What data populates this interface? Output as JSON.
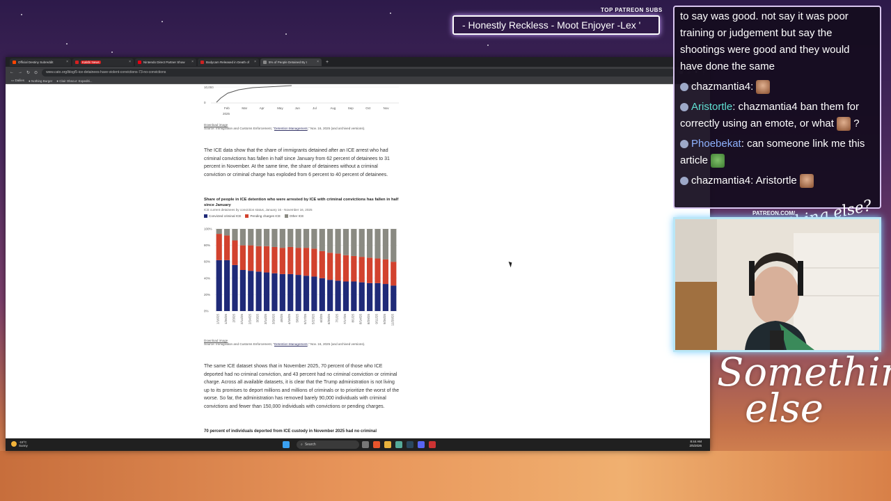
{
  "overlay": {
    "patreon_label": "TOP PATREON SUBS",
    "ticker": "- Honestly Reckless - Moot Enjoyer -Lex '",
    "patreon_url": "PATREON.COM/",
    "signature_small": "Anything else?",
    "signature": "Something else"
  },
  "chat": [
    {
      "user": "",
      "text": "to say was good. not say it was poor training or judgement but say the shootings were good and they would have done the same",
      "color": "#ffffff"
    },
    {
      "user": "chazmantia4",
      "text": "",
      "color": "#ffffff",
      "emote": "emote-face"
    },
    {
      "user": "Aristortle",
      "text": "chazmantia4 ban them for correctly using an emote, or what",
      "suffix": "?",
      "color": "#5fe0d2",
      "emote": "emote-face"
    },
    {
      "user": "Phoebekat",
      "text": "can someone link me this article",
      "color": "#8fb2ff",
      "emote": "emote-pepe"
    },
    {
      "user": "chazmantia4",
      "text": "Aristortle",
      "color": "#ffffff",
      "emote": "emote-face"
    }
  ],
  "browser": {
    "tabs": [
      {
        "label": "Official Destiny Subreddit",
        "color": "#ff4500"
      },
      {
        "label": "Kalshi News",
        "color": "#d42020",
        "badge": true
      },
      {
        "label": "Nintendo Direct Partner Show",
        "color": "#e60012"
      },
      {
        "label": "Bodycam Released in Death of",
        "color": "#cc2222"
      },
      {
        "label": "5% of People Detained By I",
        "color": "#888888",
        "active": true
      }
    ],
    "url": "www.cato.org/blog/5-ice-detainees-have-violent-convictions-73-no-convictions",
    "bookmarks": [
      "Dailies",
      "Nothing Burger",
      "Clair Obscur: Expediti..."
    ]
  },
  "article": {
    "top_chart": {
      "y_labels": [
        "10,000",
        "0"
      ],
      "months": [
        "Feb",
        "Mar",
        "Apr",
        "May",
        "Jun",
        "Jul",
        "Aug",
        "Sep",
        "Oct",
        "Nov"
      ],
      "year": "2025",
      "download": "Download image",
      "source_prefix": "Source: Immigration and Customs Enforcement, \"",
      "source_link": "Detention Management",
      "source_suffix": ",\" Nov. 16, 2025 (and archived versions)."
    },
    "para1": "The ICE data show that the share of immigrants detained after an ICE arrest who had criminal convictions has fallen in half since January from 62 percent of detainees to 31 percent in November. At the same time, the share of detainees without a criminal conviction or criminal charge has exploded from 6 percent to 40 percent of detainees.",
    "chart2": {
      "title": "Share of people in ICE detention who were arrested by ICE with criminal convictions has fallen in half since January",
      "subtitle": "ICE current detainees by conviction status, January 16 - November 16, 2025",
      "legend": [
        {
          "label": "Convicted criminal ICE",
          "color": "#1f2a78"
        },
        {
          "label": "Pending charges ICE",
          "color": "#d2422e"
        },
        {
          "label": "Other ICE",
          "color": "#8a8a82"
        }
      ],
      "download": "Download image",
      "source_prefix": "Source: Immigration and Customs Enforcement, \"",
      "source_link": "Detention Management",
      "source_suffix": ",\" Nov. 16, 2025 (and archived versions)."
    },
    "para2": "The same ICE dataset shows that in November 2025, 70 percent of those who ICE deported had no criminal conviction, and 43 percent had no criminal conviction or criminal charge. Across all available datasets, it is clear that the Trump administration is not living up to its promises to deport millions and millions of criminals or to prioritize the worst of the worse. So far, the administration has removed barely 90,000 individuals with criminal convictions and fewer than 150,000 individuals with convictions or pending charges.",
    "next_heading": "70 percent of individuals deported from ICE custody in November 2025 had no criminal"
  },
  "taskbar": {
    "weather_temp": "-15°C",
    "weather_desc": "Sunny",
    "search_placeholder": "Search",
    "time": "8:44 AM",
    "date": "2/5/2026"
  },
  "chart_data": {
    "type": "bar",
    "stacked": true,
    "categories": [
      "1/16/25",
      "1/26/25",
      "2/3/25",
      "2/14/25",
      "2/24/25",
      "3/3/25",
      "3/14/25",
      "3/26/25",
      "4/6/25",
      "4/16/25",
      "5/6/25",
      "5/17/25",
      "5/23/25",
      "6/3/25",
      "6/20/25",
      "7/1/25",
      "7/17/25",
      "8/1/25",
      "8/14/25",
      "8/29/25",
      "9/11/25",
      "9/26/25",
      "11/20/25"
    ],
    "series": [
      {
        "name": "Convicted criminal ICE",
        "values": [
          62,
          62,
          56,
          50,
          49,
          48,
          47,
          46,
          45,
          45,
          44,
          43,
          42,
          40,
          38,
          37,
          36,
          36,
          35,
          34,
          34,
          33,
          31
        ]
      },
      {
        "name": "Pending charges ICE",
        "values": [
          32,
          30,
          30,
          30,
          31,
          31,
          32,
          32,
          32,
          33,
          33,
          34,
          34,
          33,
          33,
          33,
          32,
          31,
          31,
          31,
          30,
          30,
          29
        ]
      },
      {
        "name": "Other ICE",
        "values": [
          6,
          8,
          14,
          20,
          20,
          21,
          21,
          22,
          23,
          22,
          23,
          23,
          24,
          27,
          29,
          30,
          32,
          33,
          34,
          35,
          36,
          37,
          40
        ]
      }
    ],
    "yticks": [
      "0%",
      "20%",
      "40%",
      "60%",
      "80%",
      "100%"
    ],
    "ylim": [
      0,
      100
    ]
  }
}
